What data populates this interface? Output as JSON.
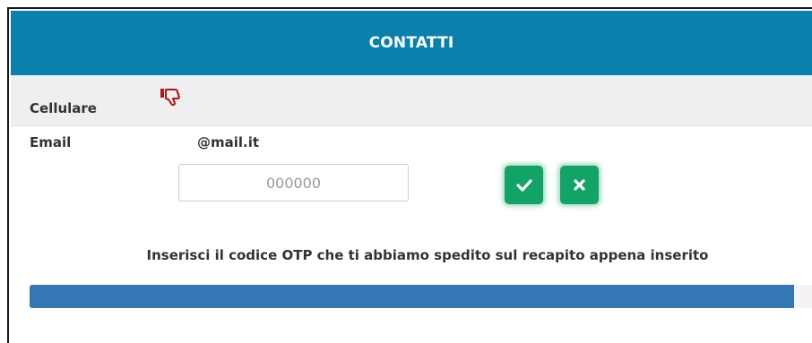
{
  "header": {
    "title": "CONTATTI"
  },
  "contacts": {
    "cellulare": {
      "label": "Cellulare",
      "status_icon": "thumbs-down-icon",
      "icon_color": "#b01818"
    },
    "email": {
      "label": "Email",
      "value": "@mail.it"
    }
  },
  "otp": {
    "placeholder": "000000",
    "value": ""
  },
  "actions": {
    "confirm_icon": "check-icon",
    "cancel_icon": "close-icon",
    "button_color": "#12a367"
  },
  "message": "Inserisci il codice OTP che ti abbiamo spedito sul recapito appena inserito",
  "progress": {
    "percent": 97.5,
    "color": "#3378b4"
  },
  "colors": {
    "header_bg": "#0a80ad",
    "row_bg": "#efefef"
  }
}
